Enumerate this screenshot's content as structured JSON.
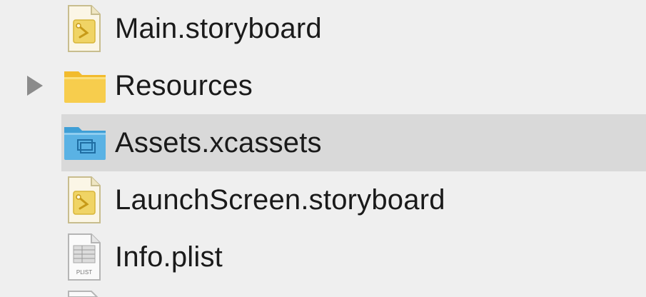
{
  "navigator": {
    "items": [
      {
        "label": "Main.storyboard",
        "icon": "storyboard-file-icon"
      },
      {
        "label": "Resources",
        "icon": "folder-icon"
      },
      {
        "label": "Assets.xcassets",
        "icon": "asset-catalog-icon"
      },
      {
        "label": "LaunchScreen.storyboard",
        "icon": "storyboard-file-icon"
      },
      {
        "label": "Info.plist",
        "icon": "plist-file-icon",
        "icon_caption": "PLIST"
      }
    ]
  },
  "colors": {
    "background": "#efefef",
    "selection": "#d9d9d9",
    "folder_yellow": "#f5c744",
    "asset_blue": "#5ab2e4",
    "storyboard_yellow": "#f0d465"
  }
}
